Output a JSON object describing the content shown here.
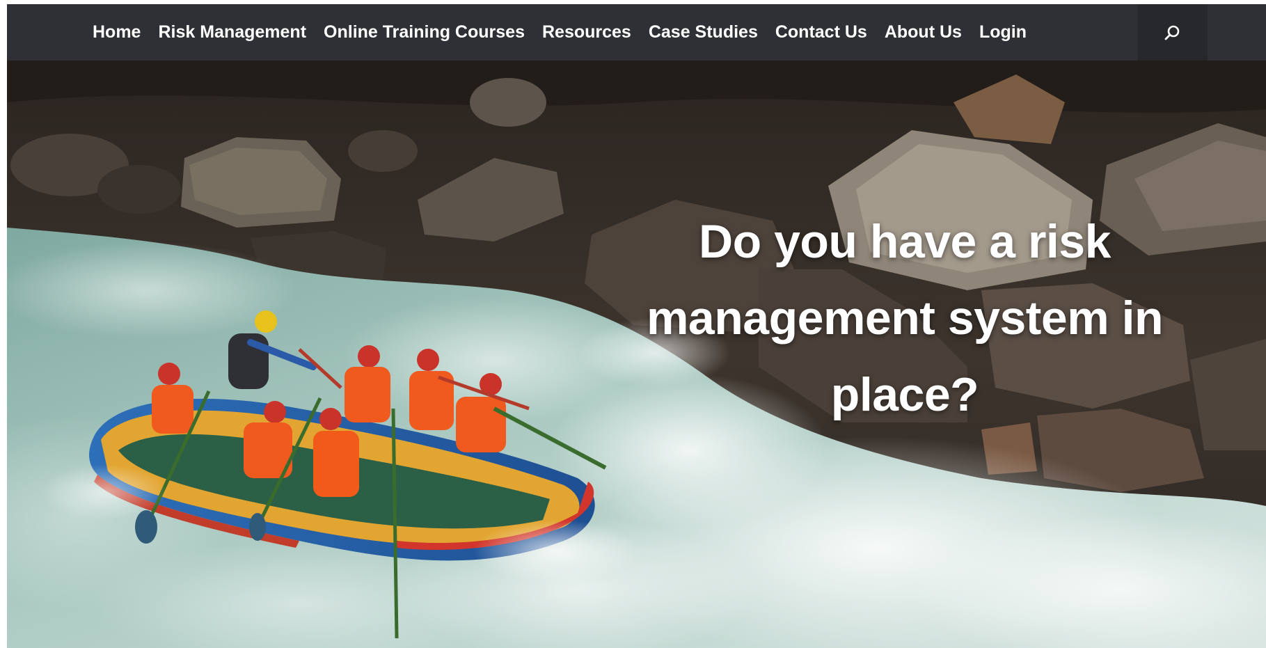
{
  "nav": {
    "items": [
      {
        "label": "Home"
      },
      {
        "label": "Risk Management"
      },
      {
        "label": "Online Training Courses"
      },
      {
        "label": "Resources"
      },
      {
        "label": "Case Studies"
      },
      {
        "label": "Contact Us"
      },
      {
        "label": "About Us"
      },
      {
        "label": "Login"
      }
    ],
    "search_icon": "search-icon"
  },
  "hero": {
    "heading": "Do you have a risk management system in place?",
    "image": "white-water-rafting-photo"
  },
  "colors": {
    "navbar_bg": "#2e3035",
    "search_bg": "#26282c",
    "nav_text": "#ffffff",
    "hero_text": "#ffffff"
  }
}
